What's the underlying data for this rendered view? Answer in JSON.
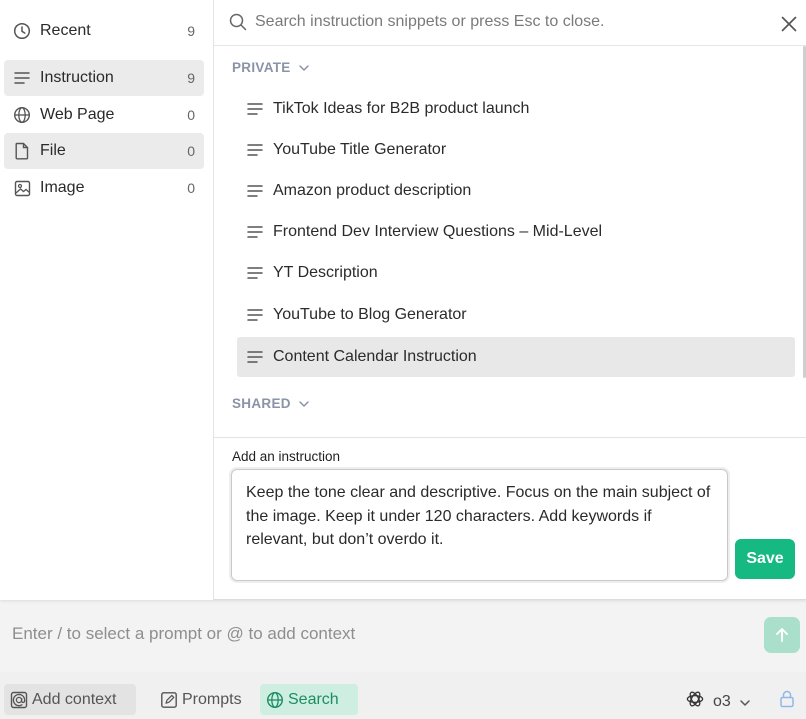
{
  "sidebar": {
    "items": [
      {
        "label": "Recent",
        "count": "9",
        "icon": "clock-icon"
      },
      {
        "label": "Instruction",
        "count": "9",
        "icon": "lines-icon"
      },
      {
        "label": "Web Page",
        "count": "0",
        "icon": "globe-icon"
      },
      {
        "label": "File",
        "count": "0",
        "icon": "file-icon"
      },
      {
        "label": "Image",
        "count": "0",
        "icon": "image-icon"
      }
    ]
  },
  "search": {
    "placeholder": "Search instruction snippets or press Esc to close.",
    "icon": "search-icon",
    "close_icon": "close-icon"
  },
  "sections": {
    "private": "PRIVATE",
    "shared": "SHARED"
  },
  "snippets": [
    "TikTok Ideas for B2B product launch",
    "YouTube Title Generator",
    "Amazon product description",
    "Frontend Dev Interview Questions – Mid-Level",
    "YT Description",
    "YouTube to Blog Generator",
    "Content Calendar Instruction"
  ],
  "add_instruction": {
    "label": "Add an instruction",
    "text": "Keep the tone clear and descriptive. Focus on the main subject of the image. Keep it under 120 characters. Add keywords if relevant, but don’t overdo it.",
    "save_label": "Save"
  },
  "composer": {
    "placeholder": "Enter / to select a prompt or @ to add context"
  },
  "toolbar": {
    "add_context": "Add context",
    "prompts": "Prompts",
    "search": "Search",
    "model": "o3"
  },
  "colors": {
    "accent": "#16b982",
    "search_chip_bg": "#cdeee0",
    "send_button": "#a9dfcb"
  }
}
